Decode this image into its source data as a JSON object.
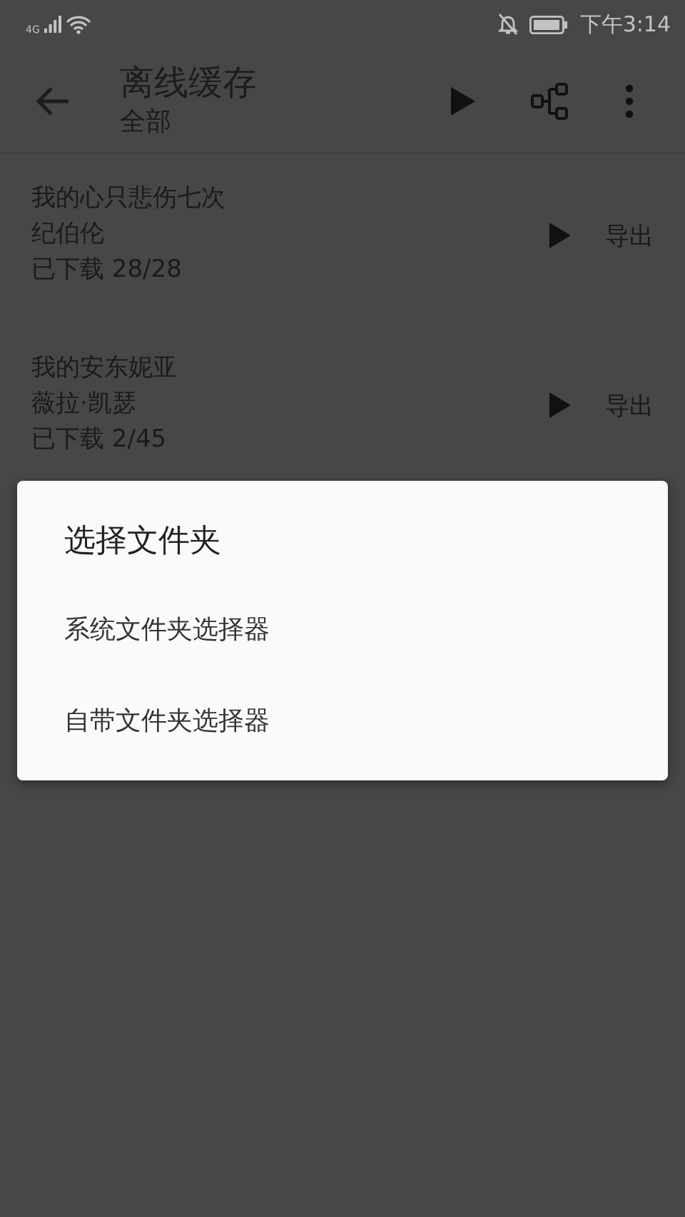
{
  "status_bar": {
    "network": "4G",
    "time": "下午3:14"
  },
  "app_bar": {
    "title": "离线缓存",
    "subtitle": "全部"
  },
  "items": [
    {
      "title": "我的心只悲伤七次",
      "artist": "纪伯伦",
      "progress": "已下载 28/28",
      "action": "导出"
    },
    {
      "title": "我的安东妮亚",
      "artist": "薇拉·凯瑟",
      "progress": "已下载 2/45",
      "action": "导出"
    }
  ],
  "dialog": {
    "title": "选择文件夹",
    "options": [
      "系统文件夹选择器",
      "自带文件夹选择器"
    ]
  }
}
